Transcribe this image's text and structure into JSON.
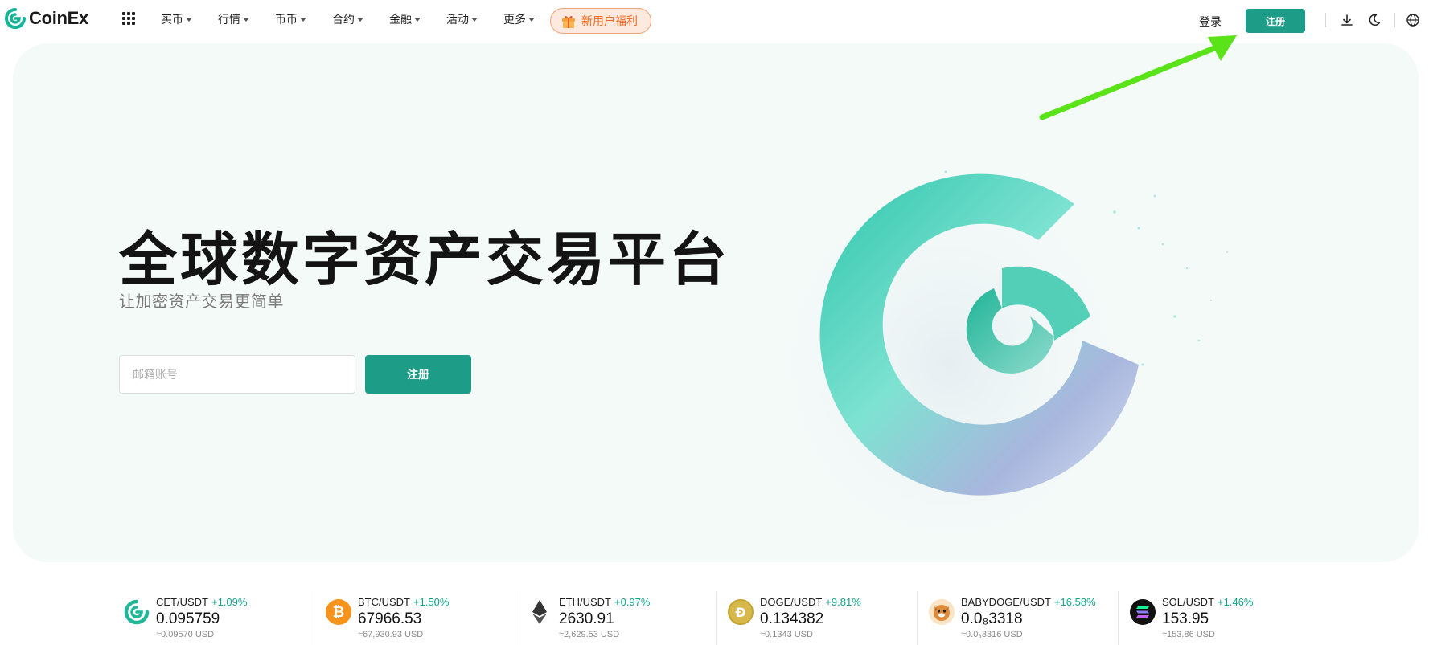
{
  "brand": {
    "name": "CoinEx",
    "accent": "#1d9d88"
  },
  "nav": {
    "menu": [
      {
        "label": "买币"
      },
      {
        "label": "行情"
      },
      {
        "label": "币币"
      },
      {
        "label": "合约"
      },
      {
        "label": "金融"
      },
      {
        "label": "活动"
      },
      {
        "label": "更多"
      }
    ],
    "promo_label": "新用户福利",
    "login_label": "登录",
    "signup_label": "注册",
    "icons": [
      "apps-grid-icon",
      "gift-icon",
      "download-icon",
      "moon-icon",
      "globe-icon"
    ]
  },
  "hero": {
    "title": "全球数字资产交易平台",
    "subtitle": "让加密资产交易更简单",
    "email_placeholder": "邮箱账号",
    "signup_label": "注册"
  },
  "tickers": [
    {
      "pair": "CET/USDT",
      "change": "+1.09%",
      "price": "0.095759",
      "usd": "≈0.09570 USD",
      "icon": "cet-icon",
      "color": "#1fb99a"
    },
    {
      "pair": "BTC/USDT",
      "change": "+1.50%",
      "price": "67966.53",
      "usd": "≈67,930.93 USD",
      "icon": "btc-icon",
      "color": "#f7931a"
    },
    {
      "pair": "ETH/USDT",
      "change": "+0.97%",
      "price": "2630.91",
      "usd": "≈2,629.53 USD",
      "icon": "eth-icon",
      "color": "#3c3c3d"
    },
    {
      "pair": "DOGE/USDT",
      "change": "+9.81%",
      "price": "0.134382",
      "usd": "≈0.1343 USD",
      "icon": "doge-icon",
      "color": "#c2a633"
    },
    {
      "pair": "BABYDOGE/USDT",
      "change": "+16.58%",
      "price": "0.0₈3318",
      "usd": "≈0.0₈3316 USD",
      "icon": "babydoge-icon",
      "color": "#e08a3c"
    },
    {
      "pair": "SOL/USDT",
      "change": "+1.46%",
      "price": "153.95",
      "usd": "≈153.86 USD",
      "icon": "sol-icon",
      "color": "#111111"
    }
  ]
}
